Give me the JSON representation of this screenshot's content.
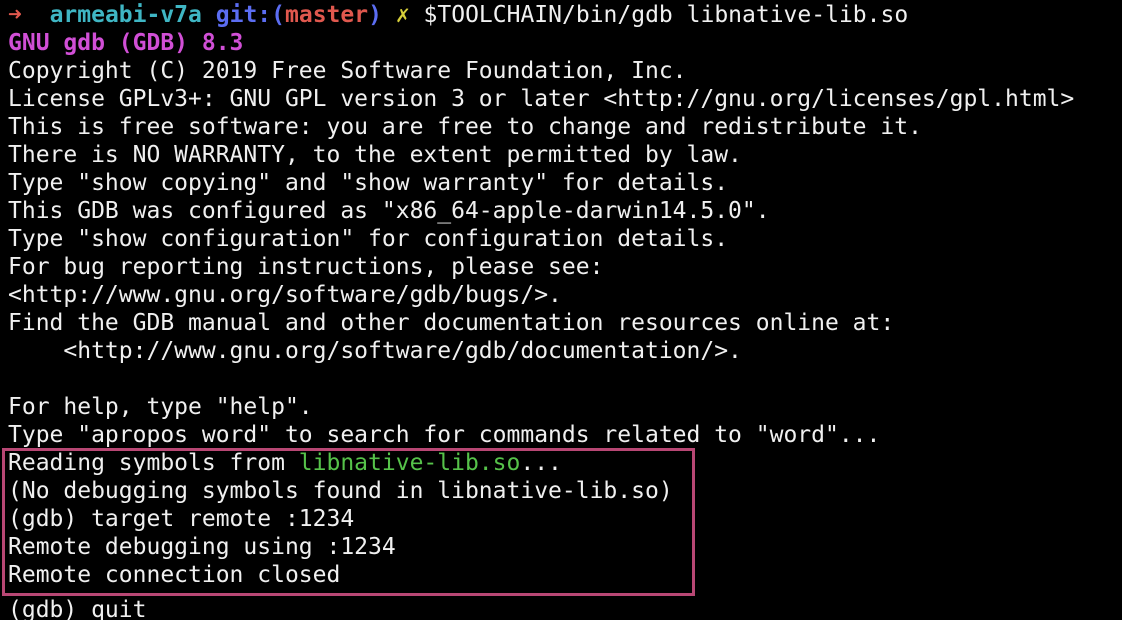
{
  "prompt": {
    "arrow": "➜",
    "dir": "armeabi-v7a",
    "git_prefix": "git:(",
    "branch": "master",
    "git_suffix": ")",
    "dirty": "✗",
    "command": "$TOOLCHAIN/bin/gdb libnative-lib.so"
  },
  "output": {
    "gdb_version": "GNU gdb (GDB) 8.3",
    "lines": [
      "Copyright (C) 2019 Free Software Foundation, Inc.",
      "License GPLv3+: GNU GPL version 3 or later <http://gnu.org/licenses/gpl.html>",
      "This is free software: you are free to change and redistribute it.",
      "There is NO WARRANTY, to the extent permitted by law.",
      "Type \"show copying\" and \"show warranty\" for details.",
      "This GDB was configured as \"x86_64-apple-darwin14.5.0\".",
      "Type \"show configuration\" for configuration details.",
      "For bug reporting instructions, please see:",
      "<http://www.gnu.org/software/gdb/bugs/>.",
      "Find the GDB manual and other documentation resources online at:",
      "    <http://www.gnu.org/software/gdb/documentation/>.",
      "",
      "For help, type \"help\".",
      "Type \"apropos word\" to search for commands related to \"word\"..."
    ],
    "reading_prefix": "Reading symbols from ",
    "reading_file": "libnative-lib.so",
    "reading_suffix": "...",
    "highlighted": [
      "(No debugging symbols found in libnative-lib.so)",
      "(gdb) target remote :1234",
      "Remote debugging using :1234",
      "Remote connection closed"
    ],
    "last_line": "(gdb) quit"
  },
  "colors": {
    "background": "#000000",
    "text": "#f0f0f0",
    "highlight_border": "#b84774",
    "green": "#56c24a",
    "magenta": "#d14fd6"
  }
}
